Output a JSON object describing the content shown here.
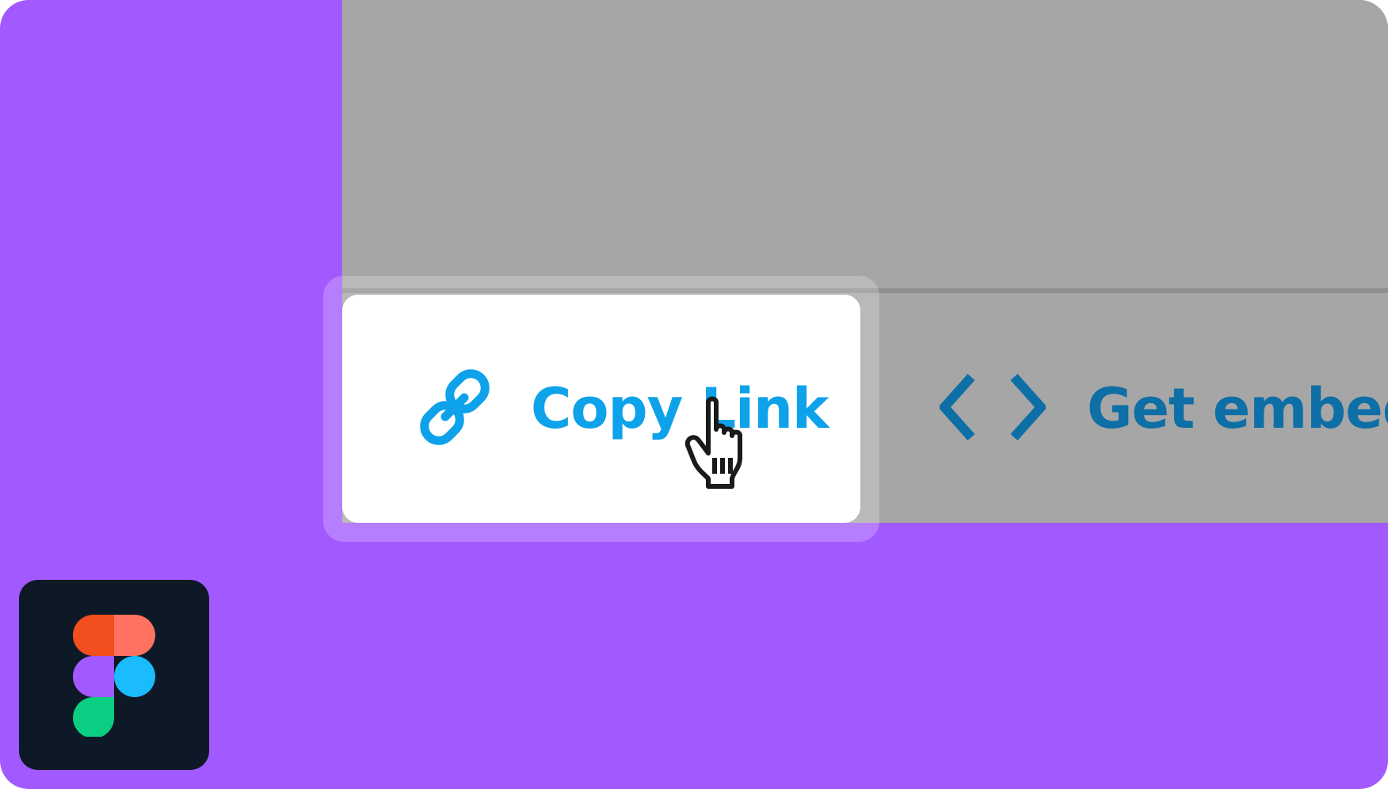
{
  "share_menu": {
    "copy_link_label": "Copy Link",
    "embed_label": "Get embed code",
    "copy_link_icon": "link-icon",
    "embed_icon": "code-brackets-icon"
  },
  "cursor": {
    "icon": "hand-pointer-cursor"
  },
  "app": {
    "logo": "figma-logo"
  },
  "colors": {
    "background": "#a259ff",
    "panel": "#a6a6a6",
    "copy_accent": "#0ea2ea",
    "embed_accent": "#0d6fa6",
    "figma_tile": "#0d1926"
  }
}
